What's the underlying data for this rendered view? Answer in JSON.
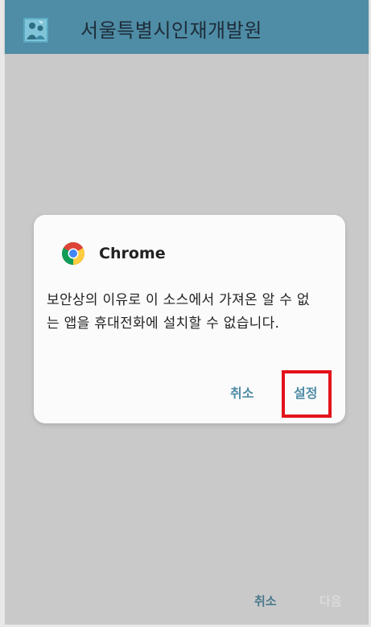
{
  "app": {
    "title": "서울특별시인재개발원",
    "icon": "app-logo-icon",
    "bar_color": "#4f8ca5"
  },
  "dialog": {
    "icon": "chrome-icon",
    "title": "Chrome",
    "message": "보안상의 이유로 이 소스에서 가져온 알 수 없는 앱을 휴대전화에 설치할 수 없습니다.",
    "buttons": {
      "cancel": "취소",
      "settings": "설정"
    },
    "accent": "#4f8ca5"
  },
  "highlight": {
    "color": "#e3121b"
  },
  "bottom": {
    "cancel": "취소",
    "next": "다음"
  }
}
